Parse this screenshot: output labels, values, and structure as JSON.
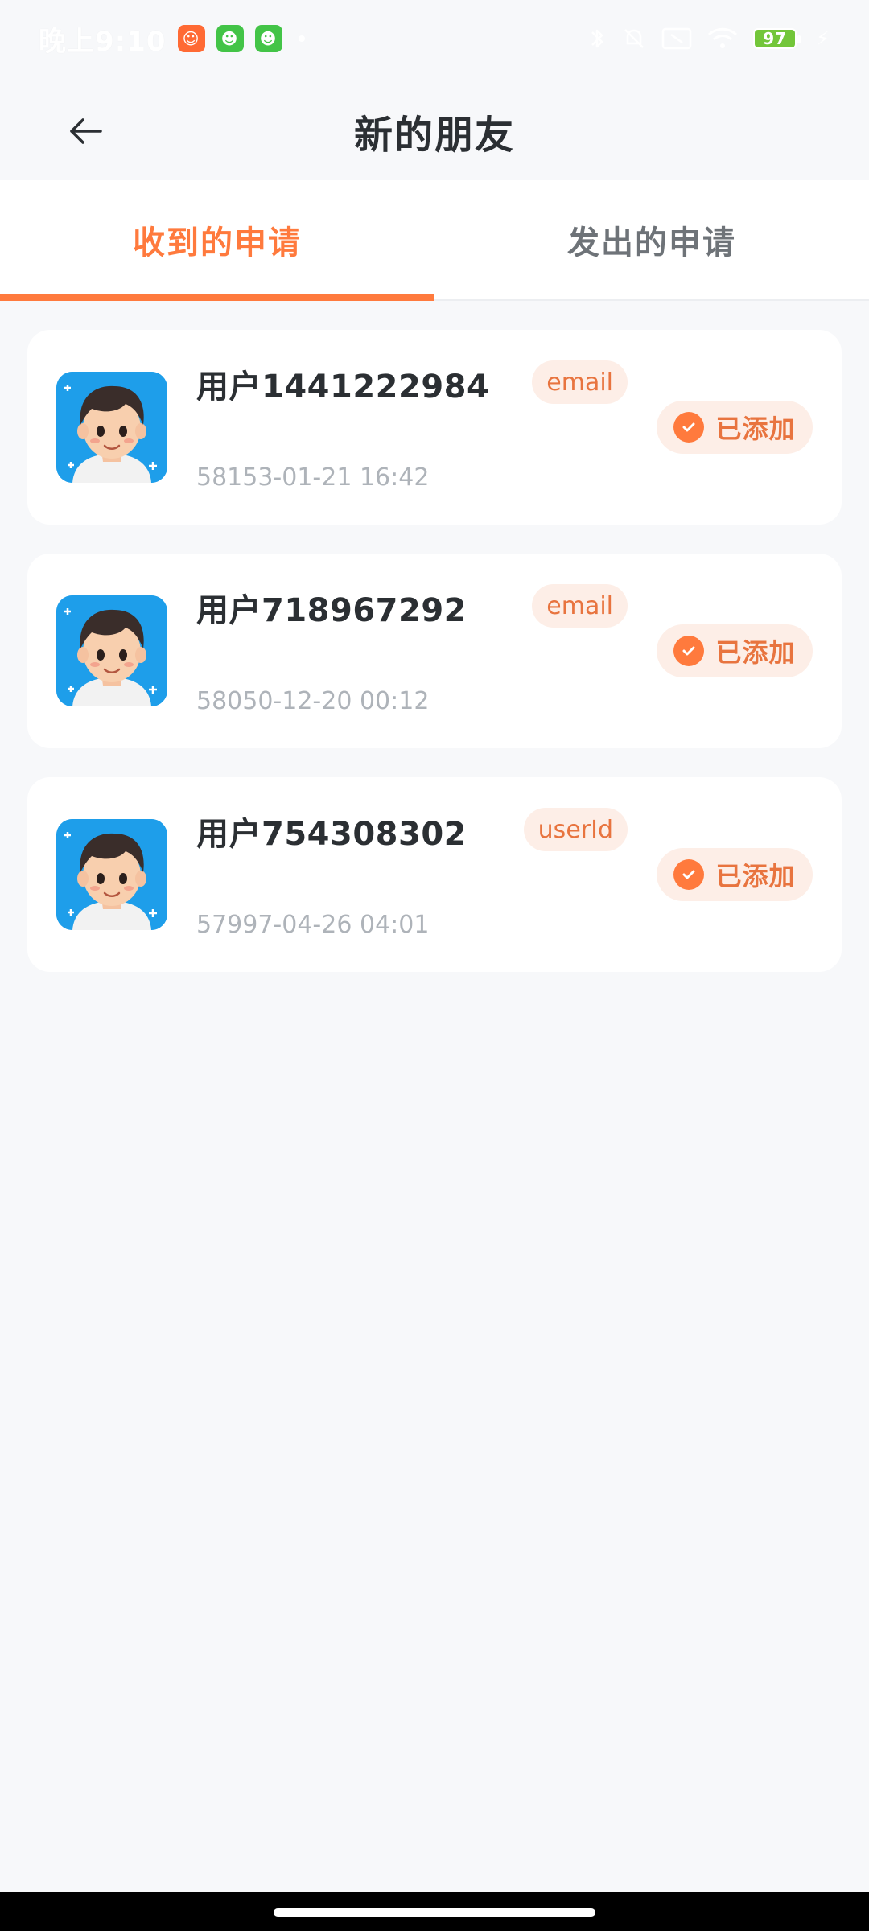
{
  "status_bar": {
    "time": "晚上9:10",
    "battery": "97"
  },
  "header": {
    "title": "新的朋友"
  },
  "tabs": [
    {
      "label": "收到的申请",
      "active": true
    },
    {
      "label": "发出的申请",
      "active": false
    }
  ],
  "requests": [
    {
      "name": "用户1441222984",
      "source": "email",
      "time": "58153-01-21 16:42",
      "status": "已添加"
    },
    {
      "name": "用户718967292",
      "source": "email",
      "time": "58050-12-20 00:12",
      "status": "已添加"
    },
    {
      "name": "用户754308302",
      "source": "userId",
      "time": "57997-04-26 04:01",
      "status": "已添加"
    }
  ],
  "colors": {
    "accent": "#ff7a3d",
    "tag_bg": "#fdeee7",
    "page_bg": "#f7f8fa"
  }
}
